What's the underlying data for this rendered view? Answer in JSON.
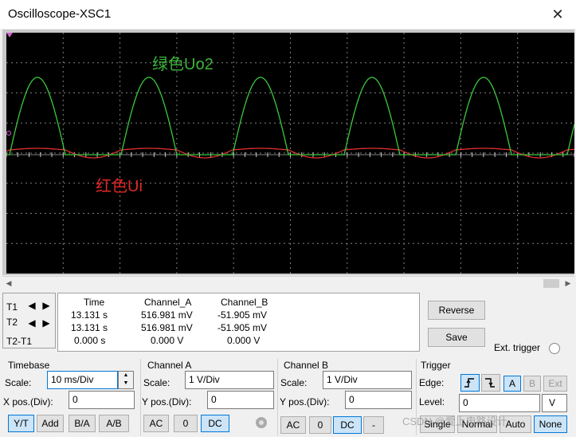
{
  "window": {
    "title": "Oscilloscope-XSC1",
    "close_glyph": "✕"
  },
  "screen": {
    "annotation_green": "绿色Uo2",
    "annotation_red": "红色Ui",
    "colors": {
      "background": "#000000",
      "grid": "#808080",
      "channel_green": "#3cc83c",
      "channel_red": "#e03030",
      "annotation_green": "#3cb43c",
      "annotation_red": "#e02828"
    }
  },
  "cursors": {
    "t1": "T1",
    "t2": "T2",
    "t2_t1": "T2-T1",
    "left_arrow_icon": "◀",
    "right_arrow_icon": "▶"
  },
  "readout": {
    "headers": [
      "Time",
      "Channel_A",
      "Channel_B"
    ],
    "rows": [
      [
        "13.131 s",
        "516.981 mV",
        "-51.905 mV"
      ],
      [
        "13.131 s",
        "516.981 mV",
        "-51.905 mV"
      ],
      [
        "0.000 s",
        "0.000 V",
        "0.000 V"
      ]
    ]
  },
  "buttons": {
    "reverse": "Reverse",
    "save": "Save",
    "ext_trigger": "Ext. trigger"
  },
  "timebase": {
    "title": "Timebase",
    "scale_label": "Scale:",
    "scale_value": "10 ms/Div",
    "xpos_label": "X pos.(Div):",
    "xpos_value": "0",
    "modes": [
      "Y/T",
      "Add",
      "B/A",
      "A/B"
    ]
  },
  "channel_a": {
    "title": "Channel A",
    "scale_label": "Scale:",
    "scale_value": "1  V/Div",
    "ypos_label": "Y pos.(Div):",
    "ypos_value": "0",
    "coupling": [
      "AC",
      "0",
      "DC"
    ]
  },
  "channel_b": {
    "title": "Channel B",
    "scale_label": "Scale:",
    "scale_value": "1  V/Div",
    "ypos_label": "Y pos.(Div):",
    "ypos_value": "0",
    "coupling": [
      "AC",
      "0",
      "DC",
      "-"
    ]
  },
  "trigger": {
    "title": "Trigger",
    "edge_label": "Edge:",
    "edge_rising_icon": "rising-edge-icon",
    "edge_falling_icon": "falling-edge-icon",
    "sources": [
      "A",
      "B",
      "Ext"
    ],
    "level_label": "Level:",
    "level_value": "0",
    "level_unit": "V",
    "modes": [
      "Single",
      "Normal",
      "Auto",
      "None"
    ]
  },
  "watermark": "CSDN @爱上电路设计"
}
